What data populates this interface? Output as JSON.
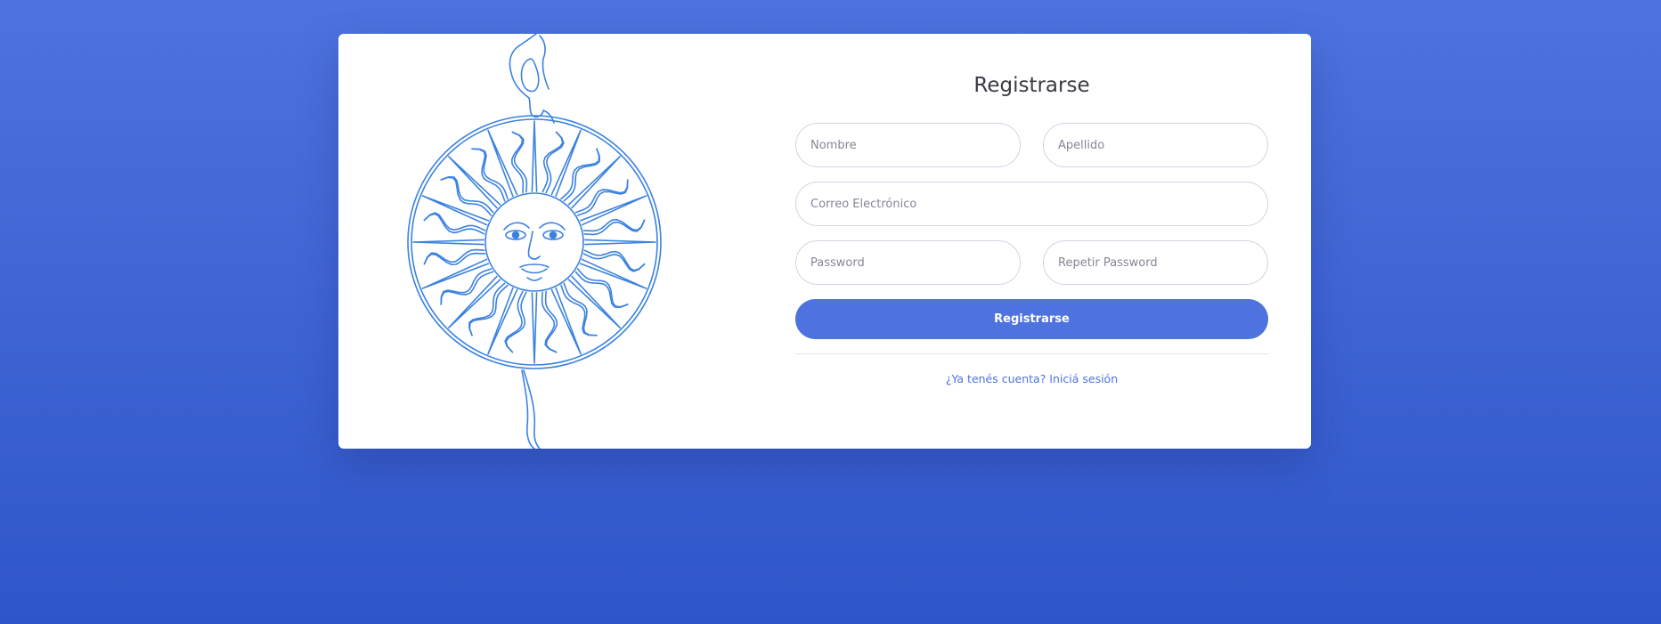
{
  "page": {
    "background_color_top": "#4e73df",
    "background_color_bottom": "#2f56c9",
    "accent_color": "#4e73df"
  },
  "illustration": {
    "name": "sol-de-mayo-icon",
    "stroke_color": "#3b82e0"
  },
  "form": {
    "title": "Registrarse",
    "fields": {
      "first_name": {
        "placeholder": "Nombre",
        "value": ""
      },
      "last_name": {
        "placeholder": "Apellido",
        "value": ""
      },
      "email": {
        "placeholder": "Correo Electrónico",
        "value": ""
      },
      "password": {
        "placeholder": "Password",
        "value": ""
      },
      "repeat_password": {
        "placeholder": "Repetir Password",
        "value": ""
      }
    },
    "submit_label": "Registrarse",
    "login_link_text": "¿Ya tenés cuenta? Iniciá sesión"
  }
}
